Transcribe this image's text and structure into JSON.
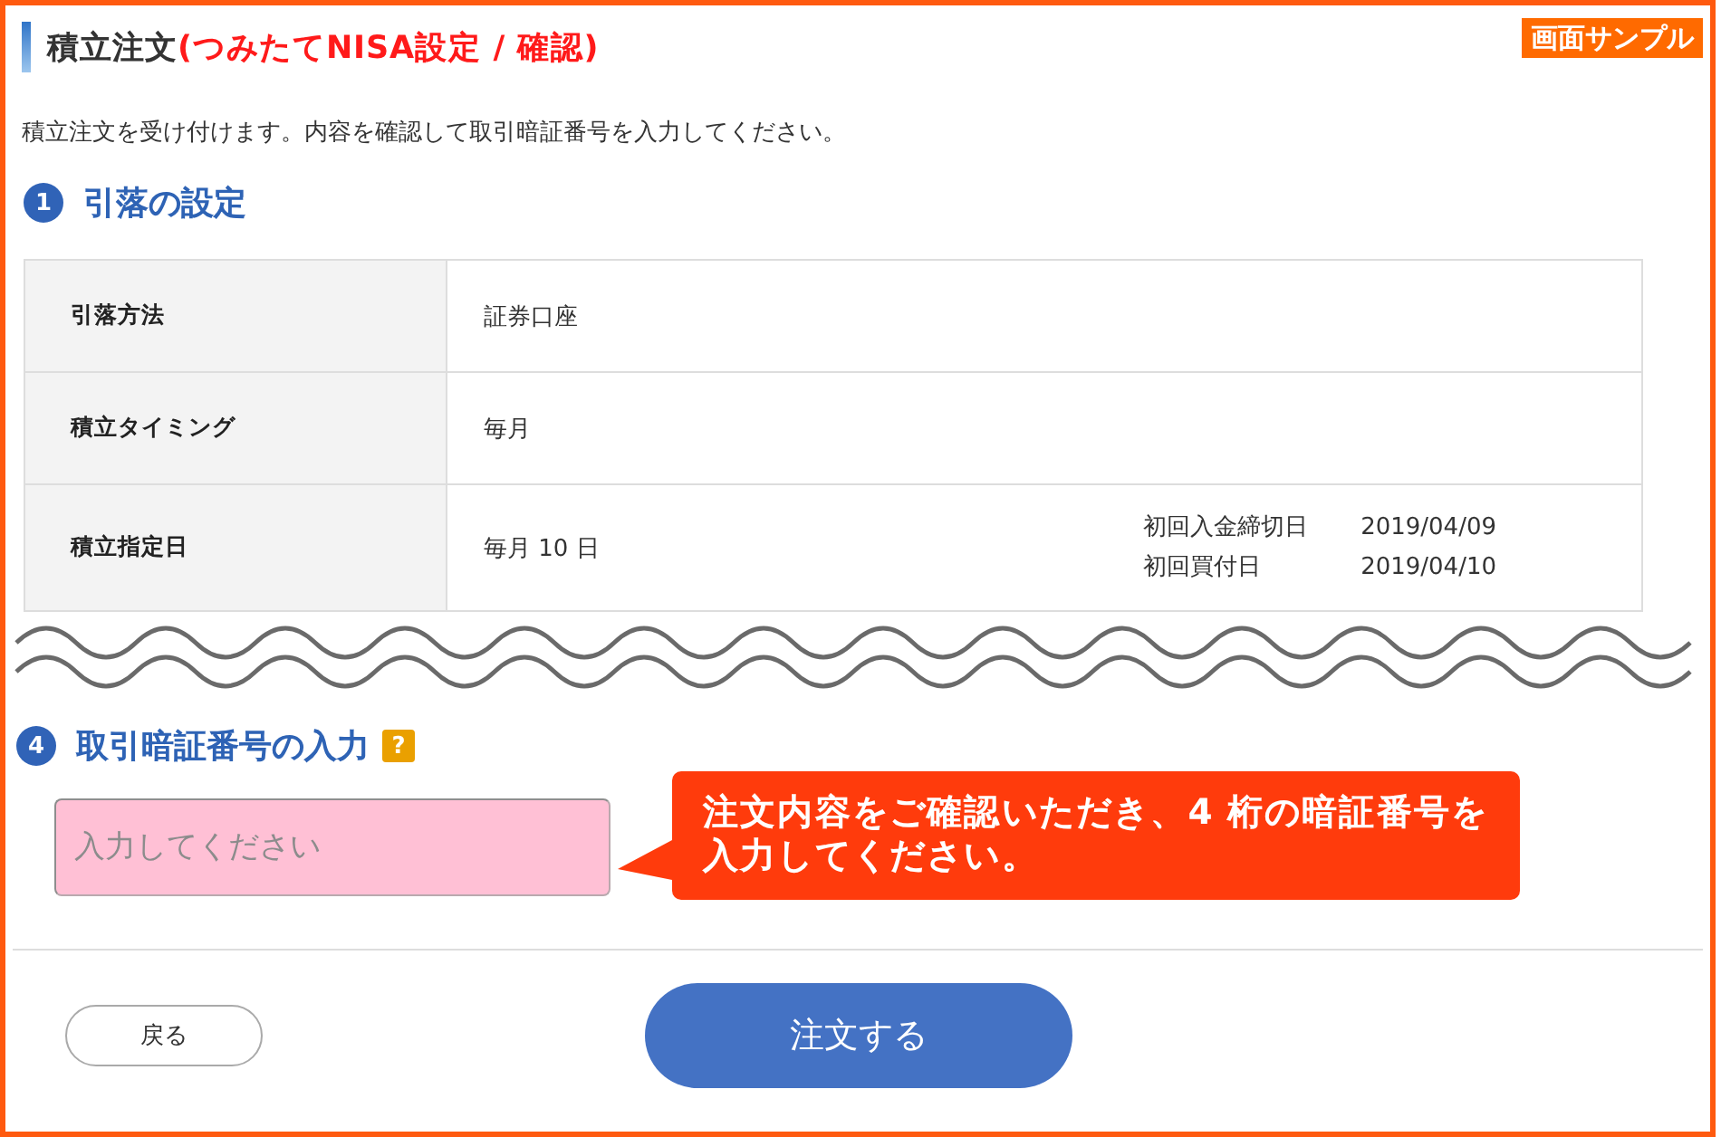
{
  "header": {
    "title": "積立注文",
    "title_note": "(つみたてNISA設定 / 確認)",
    "sample_label": "画面サンプル"
  },
  "intro": "積立注文を受け付けます。内容を確認して取引暗証番号を入力してください。",
  "sections": [
    {
      "kind": "table",
      "number": "1",
      "heading": "引落の設定",
      "rows": [
        {
          "label": "引落方法",
          "value": "証券口座"
        },
        {
          "label": "積立タイミング",
          "value": "毎月"
        },
        {
          "label": "積立指定日",
          "value": "毎月 10 日",
          "details": [
            {
              "label": "初回入金締切日",
              "value": "2019/04/09"
            },
            {
              "label": "初回買付日",
              "value": "2019/04/10"
            }
          ]
        }
      ]
    },
    {
      "kind": "pin",
      "number": "4",
      "heading": "取引暗証番号の入力",
      "help": "?",
      "pin_field": {
        "placeholder": "入力してください"
      },
      "callout": "注文内容をご確認いただき、4 桁の暗証番号を入力してください。"
    }
  ],
  "buttons": [
    {
      "kind": "back",
      "label": "戻る"
    },
    {
      "kind": "primary",
      "label": "注文する"
    }
  ]
}
